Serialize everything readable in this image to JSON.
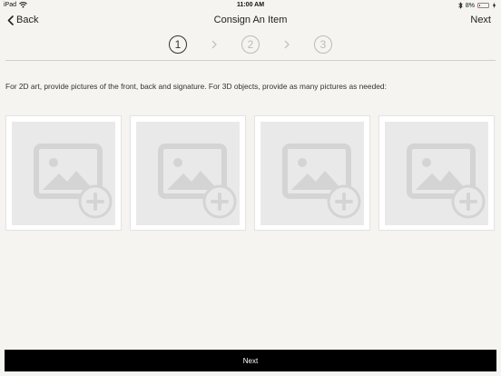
{
  "status_bar": {
    "device": "iPad",
    "time": "11:00 AM",
    "battery": "8%",
    "battery_fraction": 0.08
  },
  "nav": {
    "back_label": "Back",
    "title": "Consign An Item",
    "next_label": "Next"
  },
  "steps": [
    {
      "label": "1",
      "active": true
    },
    {
      "label": "2",
      "active": false
    },
    {
      "label": "3",
      "active": false
    }
  ],
  "instructions": "For 2D art, provide pictures of the front, back and signature.  For 3D objects, provide as many pictures as needed:",
  "photo_slots": [
    {
      "icon": "add-photo-icon"
    },
    {
      "icon": "add-photo-icon"
    },
    {
      "icon": "add-photo-icon"
    },
    {
      "icon": "add-photo-icon"
    }
  ],
  "footer": {
    "next_label": "Next"
  },
  "colors": {
    "background": "#f5f4f0",
    "button_bg": "#000000",
    "button_text": "#ffffff",
    "placeholder": "#d4d4d4",
    "battery_low": "#e0241b"
  }
}
